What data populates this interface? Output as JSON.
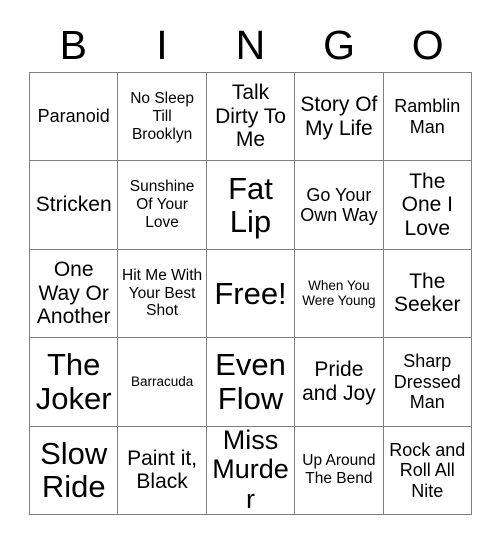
{
  "card": {
    "title": "BINGO",
    "header_letters": [
      "B",
      "I",
      "N",
      "G",
      "O"
    ],
    "border_color": "#808080",
    "text_color": "#000000",
    "background_color": "#ffffff",
    "columns": 5,
    "rows": 5,
    "free_space_label": "Free!",
    "free_space_position": "center"
  },
  "cells": [
    {
      "label": "Paranoid",
      "size": "md",
      "row": 1,
      "col": 1
    },
    {
      "label": "No Sleep Till Brooklyn",
      "size": "sm",
      "row": 1,
      "col": 2
    },
    {
      "label": "Talk Dirty To Me",
      "size": "lg",
      "row": 1,
      "col": 3
    },
    {
      "label": "Story Of My Life",
      "size": "lg",
      "row": 1,
      "col": 4
    },
    {
      "label": "Ramblin Man",
      "size": "md",
      "row": 1,
      "col": 5
    },
    {
      "label": "Stricken",
      "size": "lg",
      "row": 2,
      "col": 1
    },
    {
      "label": "Sunshine Of Your Love",
      "size": "sm",
      "row": 2,
      "col": 2
    },
    {
      "label": "Fat Lip",
      "size": "xxl",
      "row": 2,
      "col": 3
    },
    {
      "label": "Go Your Own Way",
      "size": "md",
      "row": 2,
      "col": 4
    },
    {
      "label": "The One I Love",
      "size": "lg",
      "row": 2,
      "col": 5
    },
    {
      "label": "One Way Or Another",
      "size": "lg",
      "row": 3,
      "col": 1
    },
    {
      "label": "Hit Me With Your Best Shot",
      "size": "sm",
      "row": 3,
      "col": 2
    },
    {
      "label": "Free!",
      "size": "xxl",
      "row": 3,
      "col": 3
    },
    {
      "label": "When You Were Young",
      "size": "xs",
      "row": 3,
      "col": 4
    },
    {
      "label": "The Seeker",
      "size": "lg",
      "row": 3,
      "col": 5
    },
    {
      "label": "The Joker",
      "size": "xxl",
      "row": 4,
      "col": 1
    },
    {
      "label": "Barracuda",
      "size": "xs",
      "row": 4,
      "col": 2
    },
    {
      "label": "Even Flow",
      "size": "xxl",
      "row": 4,
      "col": 3
    },
    {
      "label": "Pride and Joy",
      "size": "lg",
      "row": 4,
      "col": 4
    },
    {
      "label": "Sharp Dressed Man",
      "size": "md",
      "row": 4,
      "col": 5
    },
    {
      "label": "Slow Ride",
      "size": "xxl",
      "row": 5,
      "col": 1
    },
    {
      "label": "Paint it, Black",
      "size": "lg",
      "row": 5,
      "col": 2
    },
    {
      "label": "Miss Murder",
      "size": "xl",
      "row": 5,
      "col": 3
    },
    {
      "label": "Up Around The Bend",
      "size": "sm",
      "row": 5,
      "col": 4
    },
    {
      "label": "Rock and Roll All Nite",
      "size": "md",
      "row": 5,
      "col": 5
    }
  ]
}
